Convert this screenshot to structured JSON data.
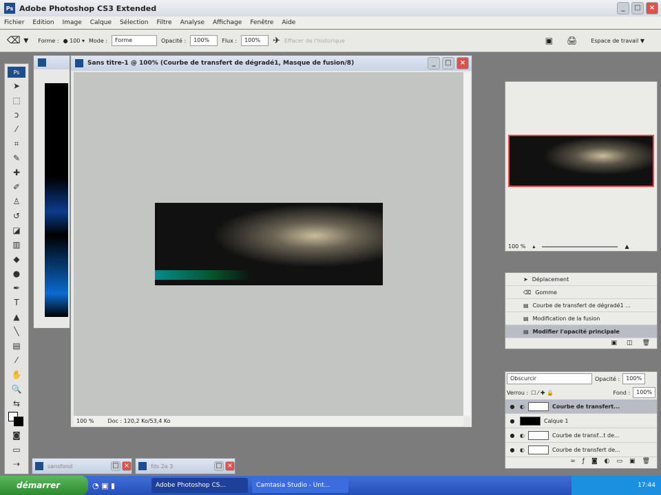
{
  "app": {
    "title": "Adobe Photoshop CS3 Extended",
    "logo": "Ps"
  },
  "menu": [
    "Fichier",
    "Edition",
    "Image",
    "Calque",
    "Sélection",
    "Filtre",
    "Analyse",
    "Affichage",
    "Fenêtre",
    "Aide"
  ],
  "options": {
    "forme_label": "Forme :",
    "forme_size": "100",
    "mode_label": "Mode :",
    "mode_value": "Forme",
    "opacite_label": "Opacité :",
    "opacite_value": "100%",
    "flux_label": "Flux :",
    "flux_value": "100%",
    "effacer_label": "Effacer de l'historique",
    "workspace": "Espace de travail ▼"
  },
  "document": {
    "title": "Sans titre-1 @ 100% (Courbe de transfert de dégradé1, Masque de fusion/8)",
    "zoom": "100 %",
    "doc_info": "Doc : 120,2 Ko/53,4 Ko"
  },
  "navigator": {
    "zoom": "100 %"
  },
  "history": {
    "items": [
      "Déplacement",
      "Gomme",
      "Courbe de transfert de dégradé1 ...",
      "Modification de la fusion",
      "Modifier l'opacité principale"
    ],
    "selected": 4
  },
  "layers": {
    "blend_mode": "Obscurcir",
    "opacity_label": "Opacité :",
    "opacity": "100%",
    "lock_label": "Verrou :",
    "fill_label": "Fond :",
    "fill": "100%",
    "items": [
      {
        "name": "Courbe de transfert...",
        "selected": true,
        "dark": false
      },
      {
        "name": "Calque 1",
        "selected": false,
        "dark": true
      },
      {
        "name": "Courbe de transf...t de...",
        "selected": false,
        "dark": false
      },
      {
        "name": "Courbe de transfert de...",
        "selected": false,
        "dark": false
      }
    ]
  },
  "minimized": [
    "sansfond",
    "fds 2a 3"
  ],
  "taskbar": {
    "start": "démarrer",
    "tasks": [
      "Adobe Photoshop CS...",
      "Camtasia Studio - Unt..."
    ],
    "clock": "17:44"
  }
}
